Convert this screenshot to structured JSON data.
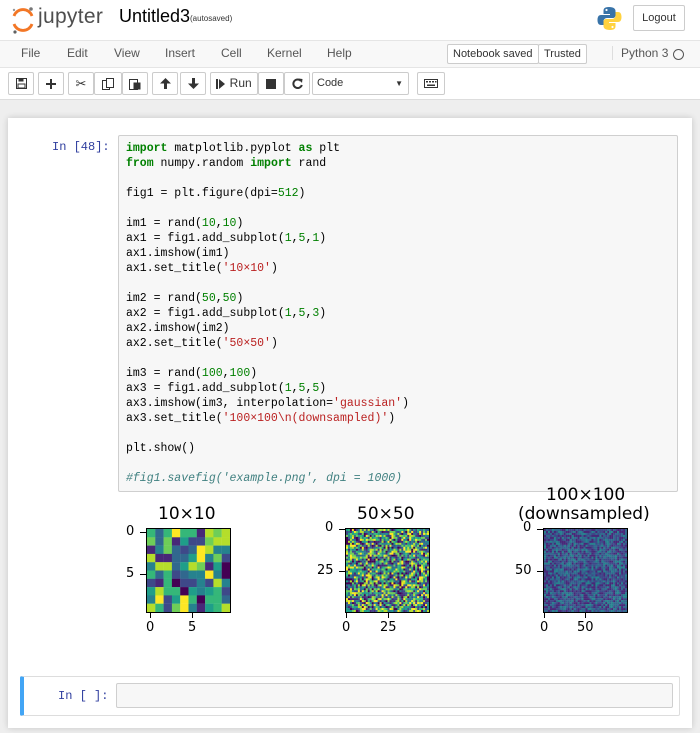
{
  "header": {
    "brand": "jupyter",
    "notebook_name": "Untitled3",
    "autosave_status": "(autosaved)",
    "logout_label": "Logout"
  },
  "menu": {
    "items": [
      "File",
      "Edit",
      "View",
      "Insert",
      "Cell",
      "Kernel",
      "Help"
    ],
    "notebook_status": "Notebook saved",
    "trusted_label": "Trusted",
    "kernel_name": "Python 3"
  },
  "toolbar": {
    "run_label": "Run",
    "cell_type": "Code",
    "buttons": [
      "save-icon",
      "plus-icon",
      "scissors-icon",
      "copy-icon",
      "paste-icon",
      "arrow-up-icon",
      "arrow-down-icon",
      "run-icon",
      "stop-icon",
      "restart-icon",
      "keyboard-icon"
    ]
  },
  "cells": [
    {
      "prompt": "In [48]:",
      "lines": [
        "import matplotlib.pyplot as plt",
        "from numpy.random import rand",
        "",
        "fig1 = plt.figure(dpi=512)",
        "",
        "im1 = rand(10,10)",
        "ax1 = fig1.add_subplot(1,5,1)",
        "ax1.imshow(im1)",
        "ax1.set_title('10×10')",
        "",
        "im2 = rand(50,50)",
        "ax2 = fig1.add_subplot(1,5,3)",
        "ax2.imshow(im2)",
        "ax2.set_title('50×50')",
        "",
        "im3 = rand(100,100)",
        "ax3 = fig1.add_subplot(1,5,5)",
        "ax3.imshow(im3, interpolation='gaussian')",
        "ax3.set_title('100×100\\n(downsampled)')",
        "",
        "plt.show()",
        "",
        "#fig1.savefig('example.png', dpi = 1000)"
      ]
    },
    {
      "prompt": "In [ ]:",
      "lines": []
    }
  ],
  "output": {
    "plots": [
      {
        "title": "10×10",
        "yticks": [
          "0",
          "5"
        ],
        "xticks": [
          "0",
          "5"
        ]
      },
      {
        "title": "50×50",
        "yticks": [
          "0",
          "25"
        ],
        "xticks": [
          "0",
          "25"
        ]
      },
      {
        "title_line1": "100×100",
        "title_line2": "(downsampled)",
        "yticks": [
          "0",
          "50"
        ],
        "xticks": [
          "0",
          "50"
        ]
      }
    ]
  },
  "colors": {
    "viridis": [
      "#440154",
      "#482878",
      "#3e4989",
      "#31688e",
      "#26828e",
      "#1f9e89",
      "#35b779",
      "#6ece58",
      "#b5de2b",
      "#fde725"
    ],
    "accent": "#42a5f5",
    "prompt": "#303f9f"
  }
}
